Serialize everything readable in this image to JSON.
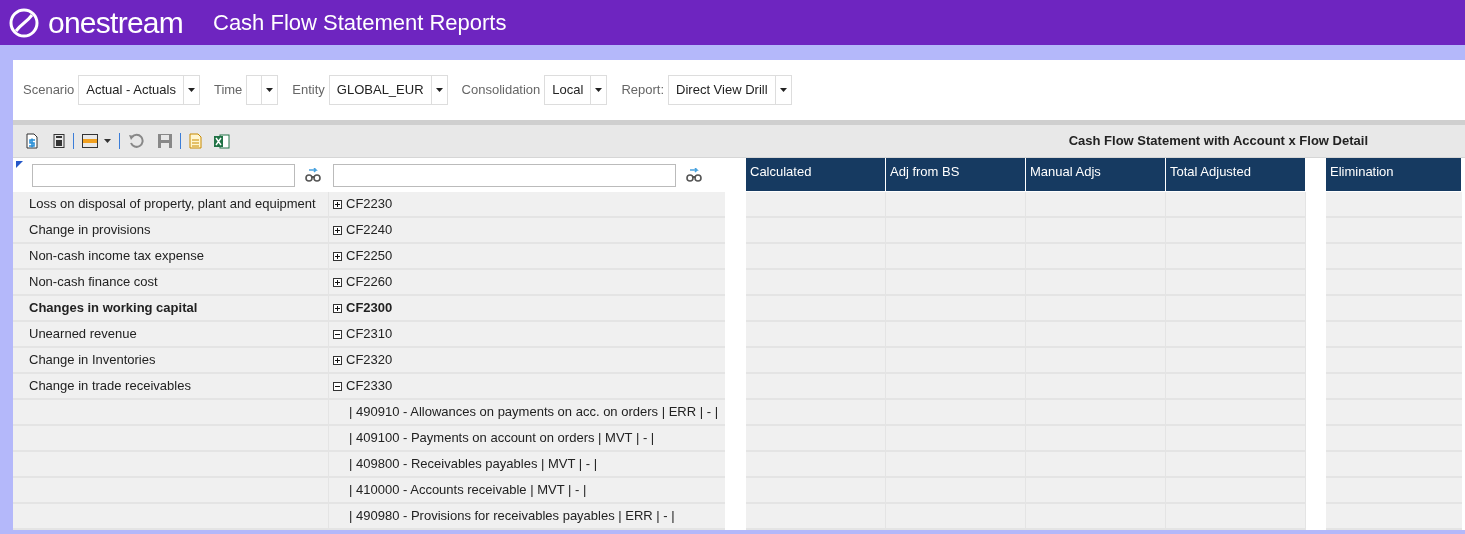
{
  "header": {
    "logo": "onestream",
    "title": "Cash Flow Statement Reports"
  },
  "filters": [
    {
      "label": "Scenario",
      "value": "Actual - Actuals"
    },
    {
      "label": "Time"
    },
    {
      "label": "Entity",
      "value": "GLOBAL_EUR"
    },
    {
      "label": "Consolidation",
      "value": "Local"
    },
    {
      "label": "Report:",
      "value": "Direct View Drill"
    }
  ],
  "report_title": "Cash Flow Statement with Account x Flow Detail",
  "columns": [
    "Calculated",
    "Adj from BS",
    "Manual Adjs",
    "Total Adjusted",
    "Elimination"
  ],
  "rows": [
    {
      "kind": "group",
      "label": "Loss on disposal of property, plant and equipment",
      "code": "CF2230",
      "expanded": false,
      "bold": false
    },
    {
      "kind": "group",
      "label": "Change in provisions",
      "code": "CF2240",
      "expanded": false,
      "bold": false
    },
    {
      "kind": "group",
      "label": "Non-cash income tax expense",
      "code": "CF2250",
      "expanded": false,
      "bold": false
    },
    {
      "kind": "group",
      "label": "Non-cash finance cost",
      "code": "CF2260",
      "expanded": false,
      "bold": false
    },
    {
      "kind": "group",
      "label": "Changes in working capital",
      "code": "CF2300",
      "expanded": false,
      "bold": true
    },
    {
      "kind": "group",
      "label": "Unearned revenue",
      "code": "CF2310",
      "expanded": true,
      "bold": false
    },
    {
      "kind": "group",
      "label": "Change in Inventories",
      "code": "CF2320",
      "expanded": false,
      "bold": false
    },
    {
      "kind": "group",
      "label": "Change in trade receivables",
      "code": "CF2330",
      "expanded": true,
      "bold": false
    },
    {
      "kind": "detail",
      "code": "| 490910 - Allowances on payments on acc. on orders | ERR | - |"
    },
    {
      "kind": "detail",
      "code": "| 409100 - Payments on account on orders | MVT | - |"
    },
    {
      "kind": "detail",
      "code": "| 409800 - Receivables payables | MVT | - |"
    },
    {
      "kind": "detail",
      "code": "| 410000 - Accounts receivable | MVT | - |"
    },
    {
      "kind": "detail",
      "code": "| 490980 - Provisions for receivables payables | ERR | - |"
    }
  ]
}
